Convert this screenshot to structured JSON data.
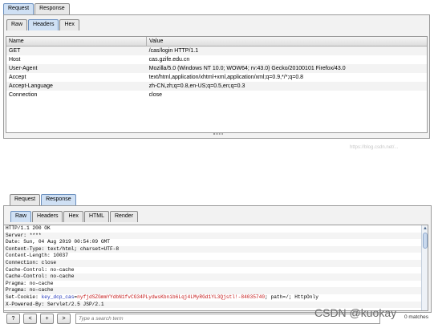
{
  "request_panel": {
    "outer_tabs": [
      "Request",
      "Response"
    ],
    "inner_tabs": [
      "Raw",
      "Headers",
      "Hex"
    ],
    "table": {
      "columns": [
        "Name",
        "Value"
      ],
      "rows": [
        {
          "name": "GET",
          "value": "/cas/login HTTP/1.1"
        },
        {
          "name": "Host",
          "value": "cas.gzife.edu.cn"
        },
        {
          "name": "User-Agent",
          "value": "Mozilla/5.0 (Windows NT 10.0; WOW64; rv:43.0) Gecko/20100101 Firefox/43.0"
        },
        {
          "name": "Accept",
          "value": "text/html,application/xhtml+xml,application/xml;q=0.9,*/*;q=0.8"
        },
        {
          "name": "Accept-Language",
          "value": "zh-CN,zh;q=0.8,en-US;q=0.5,en;q=0.3"
        },
        {
          "name": "Connection",
          "value": "close"
        }
      ]
    },
    "caption": "https://blog.csdn.net/..."
  },
  "response_panel": {
    "outer_tabs": [
      "Request",
      "Response"
    ],
    "inner_tabs": [
      "Raw",
      "Headers",
      "Hex",
      "HTML",
      "Render"
    ],
    "raw_lines": [
      "HTTP/1.1 200 OK",
      "Server: ****",
      "Date: Sun, 04 Aug 2019 00:54:09 GMT",
      "Content-Type: text/html; charset=UTF-8",
      "Content-Length: 10037",
      "Connection: close",
      "Cache-Control: no-cache",
      "Cache-Control: no-cache",
      "Pragma: no-cache",
      "Pragma: no-cache"
    ],
    "cookie_line": {
      "prefix": "Set-Cookie: ",
      "name": "key_dcp_cas",
      "eq": "=",
      "value": "nyfjdSZGmmYYdbN1fvCG34PLydwsKbnib6Lqj4LMyRGd1YL3Qjstl!-84035740",
      "suffix": "; path=/; HttpOnly"
    },
    "last_line": "X-Powered-By: Servlet/2.5 JSP/2.1",
    "search": {
      "buttons": [
        "?",
        "<",
        "+",
        ">"
      ],
      "placeholder": "Type a search term",
      "matches": "0 matches"
    }
  },
  "watermark": "CSDN @kuokay"
}
